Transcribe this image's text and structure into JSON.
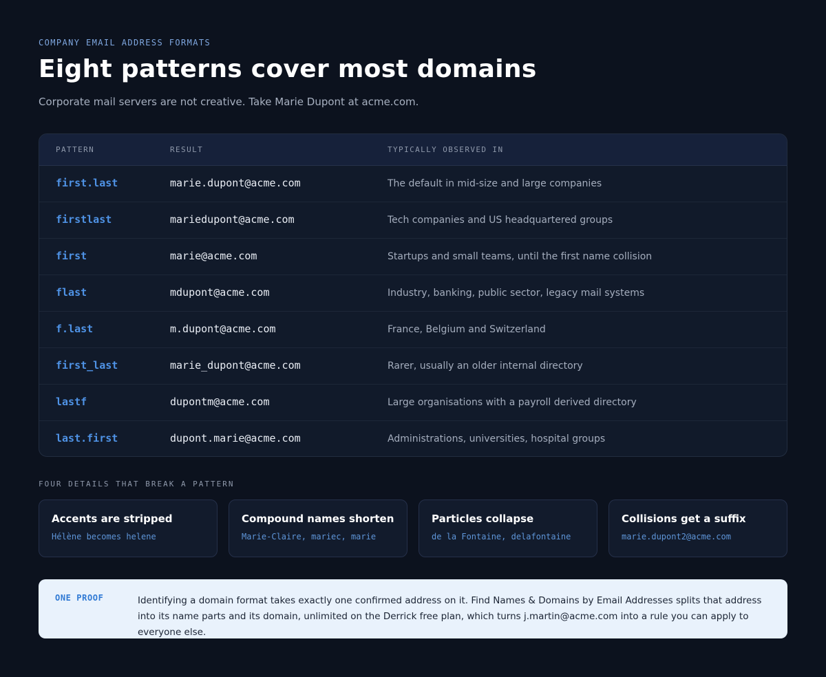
{
  "header": {
    "eyebrow": "COMPANY EMAIL ADDRESS FORMATS",
    "title": "Eight patterns cover most domains",
    "subtitle": "Corporate mail servers are not creative. Take Marie Dupont at acme.com."
  },
  "table": {
    "columns": [
      "PATTERN",
      "RESULT",
      "TYPICALLY OBSERVED IN"
    ],
    "rows": [
      {
        "pattern": "first.last",
        "result": "marie.dupont@acme.com",
        "observed": "The default in mid-size and large companies"
      },
      {
        "pattern": "firstlast",
        "result": "mariedupont@acme.com",
        "observed": "Tech companies and US headquartered groups"
      },
      {
        "pattern": "first",
        "result": "marie@acme.com",
        "observed": "Startups and small teams, until the first name collision"
      },
      {
        "pattern": "flast",
        "result": "mdupont@acme.com",
        "observed": "Industry, banking, public sector, legacy mail systems"
      },
      {
        "pattern": "f.last",
        "result": "m.dupont@acme.com",
        "observed": "France, Belgium and Switzerland"
      },
      {
        "pattern": "first_last",
        "result": "marie_dupont@acme.com",
        "observed": "Rarer, usually an older internal directory"
      },
      {
        "pattern": "lastf",
        "result": "dupontm@acme.com",
        "observed": "Large organisations with a payroll derived directory"
      },
      {
        "pattern": "last.first",
        "result": "dupont.marie@acme.com",
        "observed": "Administrations, universities, hospital groups"
      }
    ]
  },
  "details": {
    "label": "FOUR DETAILS THAT BREAK A PATTERN",
    "cards": [
      {
        "title": "Accents are stripped",
        "example": "Hélène becomes helene"
      },
      {
        "title": "Compound names shorten",
        "example": "Marie-Claire, mariec, marie"
      },
      {
        "title": "Particles collapse",
        "example": "de la Fontaine, delafontaine"
      },
      {
        "title": "Collisions get a suffix",
        "example": "marie.dupont2@acme.com"
      }
    ]
  },
  "proof": {
    "label": "ONE PROOF",
    "text": "Identifying a domain format takes exactly one confirmed address on it. Find Names & Domains by Email Addresses splits that address into its name parts and its domain, unlimited on the Derrick free plan, which turns j.martin@acme.com into a rule you can apply to everyone else."
  },
  "colors": {
    "background": "#0c121e",
    "accent": "#4f93e6",
    "proof_background": "#e9f2fc"
  }
}
